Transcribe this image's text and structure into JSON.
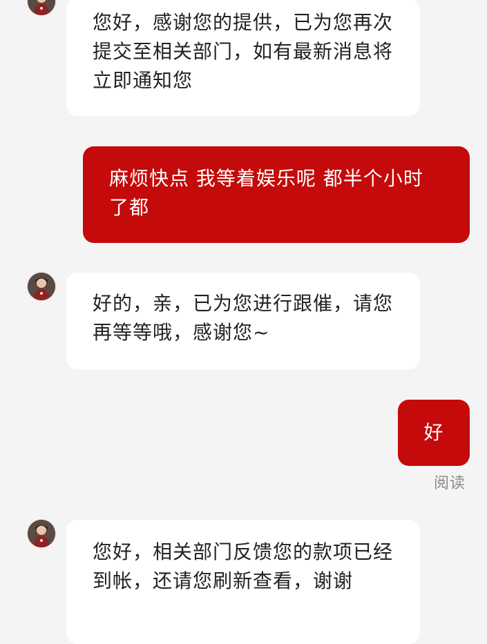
{
  "messages": [
    {
      "side": "incoming",
      "avatar": "agent-avatar-icon",
      "text": "您好，感谢您的提供，已为您再次提交至相关部门，如有最新消息将立即通知您"
    },
    {
      "side": "outgoing",
      "text": "麻烦快点 我等着娱乐呢 都半个小时了都"
    },
    {
      "side": "incoming",
      "avatar": "agent-avatar-icon",
      "text": "好的，亲，已为您进行跟催，请您再等等哦，感谢您~"
    },
    {
      "side": "outgoing",
      "text": "好",
      "status": "阅读"
    },
    {
      "side": "incoming",
      "avatar": "agent-avatar-icon",
      "text": "您好，相关部门反馈您的款项已经到帐，还请您刷新查看，谢谢"
    }
  ],
  "colors": {
    "background": "#f4f4f4",
    "incoming_bubble": "#ffffff",
    "outgoing_bubble": "#c40a0a",
    "incoming_text": "#222222",
    "outgoing_text": "#ffffff",
    "status_text": "#8a8a8a"
  }
}
